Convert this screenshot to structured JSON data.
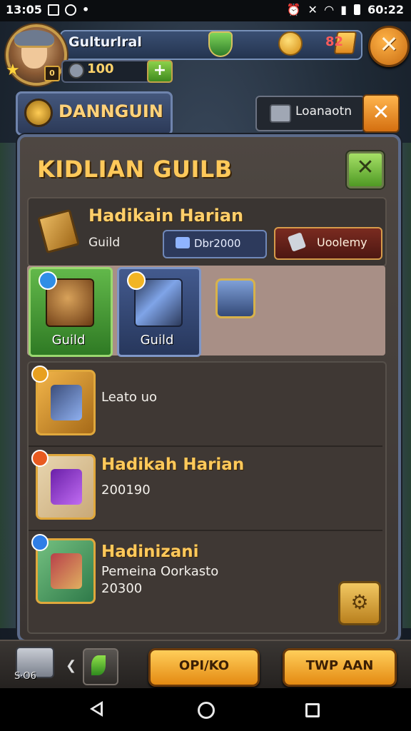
{
  "status_bar": {
    "time_left": "13:05",
    "time_right": "60:22"
  },
  "hud": {
    "player_name": "Gulturlral",
    "level_badge": "0",
    "energy_value": "100",
    "gem_count": "82"
  },
  "top_row": {
    "dungeon_label": "DANNGUIN",
    "location_label": "Loanaotn"
  },
  "panel": {
    "title": "KIDLIAN GUILB",
    "guild_name": "Hadikain Harian",
    "guild_sub": "Guild",
    "stat_text": "Dbr2000",
    "academy_label": "Uoolemy"
  },
  "tiles": [
    {
      "label": "Guild"
    },
    {
      "label": "Guild"
    }
  ],
  "list": [
    {
      "title": "",
      "text": "Leato uo",
      "text2": ""
    },
    {
      "title": "Hadikah Harian",
      "text": "200190",
      "text2": ""
    },
    {
      "title": "Hadinizani",
      "text": "Pemeina Oorkasto",
      "text2": "20300"
    }
  ],
  "bottom": {
    "shop_label": "S·O6",
    "cta_left": "OPI/KO",
    "cta_right": "TWP AAN"
  }
}
